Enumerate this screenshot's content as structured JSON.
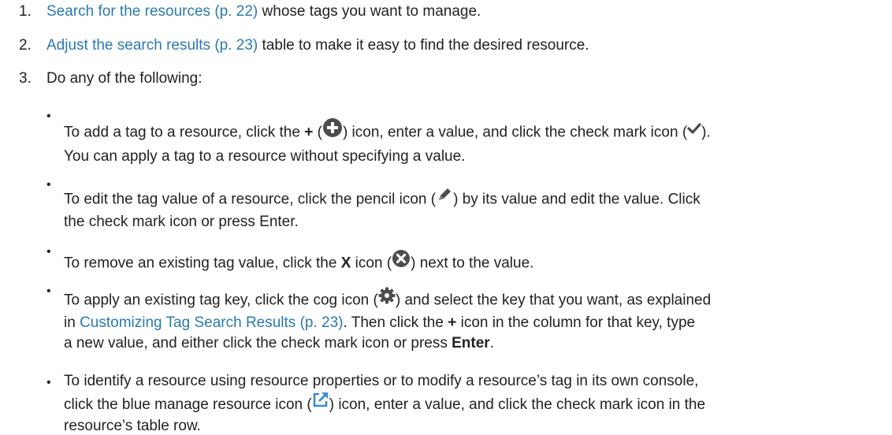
{
  "steps": [
    {
      "num": "1.",
      "link": "Search for the resources (p. 22)",
      "rest": " whose tags you want to manage."
    },
    {
      "num": "2.",
      "link": "Adjust the search results (p. 23)",
      "rest": " table to make it easy to find the desired resource."
    },
    {
      "num": "3.",
      "text": "Do any of the following:"
    }
  ],
  "bullets": {
    "b1": {
      "dot": "•",
      "t1": "To add a tag to a resource, click the ",
      "plus": "+",
      "t2": " (",
      "t3": ") icon, enter a value, and click the check mark icon (",
      "t4": ").",
      "t5": "You can apply a tag to a resource without specifying a value."
    },
    "b2": {
      "dot": "•",
      "t1": "To edit the tag value of a resource, click the pencil icon (",
      "t2": ") by its value and edit the value. Click",
      "t3": "the check mark icon or press Enter."
    },
    "b3": {
      "dot": "•",
      "t1": "To remove an existing tag value, click the ",
      "x": "X",
      "t2": " icon (",
      "t3": ") next to the value."
    },
    "b4": {
      "dot": "•",
      "t1": "To apply an existing tag key, click the cog icon (",
      "t2": ") and select the key that you want, as explained",
      "t3": "in ",
      "link": "Customizing Tag Search Results (p. 23)",
      "t4": ". Then click the ",
      "plus": "+",
      "t5": " icon in the column for that key, type",
      "t6": "a new value, and either click the check mark icon or press ",
      "enter": "Enter",
      "t7": "."
    },
    "b5": {
      "dot": "•",
      "t1": "To identify a resource using resource properties or to modify a resource’s tag in its own console,",
      "t2": "click the blue manage resource icon (",
      "t3": ") icon, enter a value, and click the check mark icon in the",
      "t4": "resource’s table row."
    }
  },
  "icons": {
    "add": "plus-circle-icon",
    "check": "check-mark-icon",
    "edit": "pencil-icon",
    "remove": "x-circle-icon",
    "settings": "cog-icon",
    "manage": "manage-resource-icon"
  },
  "colors": {
    "link": "#2a7ab0",
    "text": "#222222",
    "icon_gray": "#4d4d4d",
    "icon_blue": "#3a8bd6"
  }
}
